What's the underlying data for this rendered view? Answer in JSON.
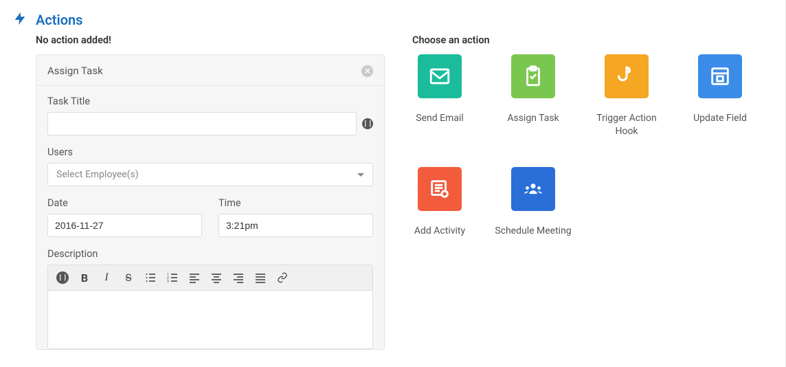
{
  "header": {
    "title": "Actions"
  },
  "left": {
    "empty_label": "No action added!",
    "card_title": "Assign Task",
    "task_title_label": "Task Title",
    "task_title_value": "",
    "users_label": "Users",
    "users_placeholder": "Select Employee(s)",
    "date_label": "Date",
    "date_value": "2016-11-27",
    "time_label": "Time",
    "time_value": "3:21pm",
    "description_label": "Description"
  },
  "right": {
    "label": "Choose an action",
    "tiles": [
      {
        "key": "send-email",
        "label": "Send Email",
        "color": "c-email"
      },
      {
        "key": "assign-task",
        "label": "Assign Task",
        "color": "c-task"
      },
      {
        "key": "trigger-hook",
        "label": "Trigger Action Hook",
        "color": "c-hook"
      },
      {
        "key": "update-field",
        "label": "Update Field",
        "color": "c-update"
      },
      {
        "key": "add-activity",
        "label": "Add Activity",
        "color": "c-activity"
      },
      {
        "key": "schedule-meeting",
        "label": "Schedule Meeting",
        "color": "c-meeting"
      }
    ]
  }
}
